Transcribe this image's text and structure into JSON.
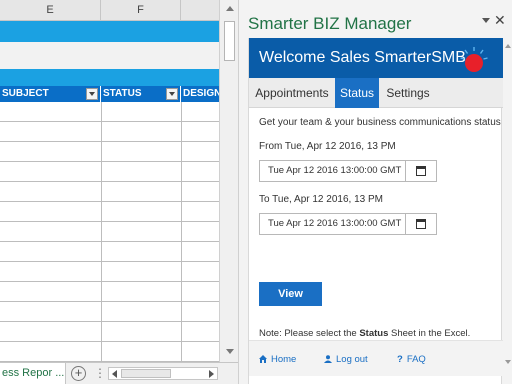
{
  "sheet": {
    "columns": [
      {
        "letter": "E"
      },
      {
        "letter": "F"
      }
    ],
    "headers": [
      "SUBJECT",
      "STATUS",
      "DESIGN"
    ],
    "sheet_tab": "ess Repor ...",
    "add_sheet_symbol": "+",
    "tab_menu_symbol": "⋮"
  },
  "pane": {
    "title": "Smarter BIZ Manager",
    "close_symbol": "✕",
    "banner_title": "Welcome Sales SmarterSMB",
    "tabs": [
      {
        "label": "Appointments",
        "active": false
      },
      {
        "label": "Status",
        "active": true
      },
      {
        "label": "Settings",
        "active": false
      }
    ],
    "status": {
      "intro": "Get your team & your business communications status",
      "from_label": "From Tue, Apr 12 2016, 13 PM",
      "from_value": "Tue Apr 12 2016 13:00:00 GMT",
      "to_label": "To Tue, Apr 12 2016, 13 PM",
      "to_value": "Tue Apr 12 2016 13:00:00 GMT",
      "view_button": "View",
      "note_prefix": "Note: Please select the ",
      "note_bold": "Status",
      "note_suffix": " Sheet in the Excel."
    },
    "footer": {
      "home": "Home",
      "logout": "Log out",
      "faq": "FAQ"
    }
  },
  "colors": {
    "accent_blue": "#1a6fc4",
    "banner_blue": "#0a5ca8",
    "sheet_band": "#1ba1e2",
    "title_green": "#217346",
    "logo_red": "#e8202a"
  }
}
